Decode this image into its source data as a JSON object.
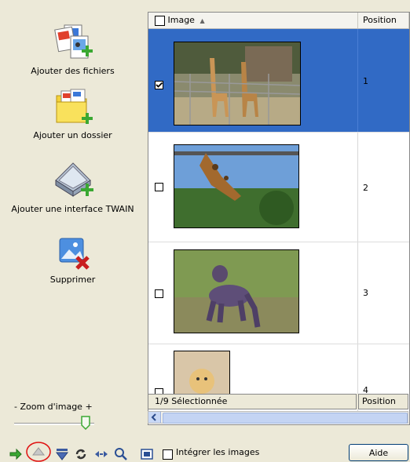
{
  "left_panel": {
    "actions": [
      {
        "label": "Ajouter des fichiers",
        "icon": "add-files-icon"
      },
      {
        "label": "Ajouter un dossier",
        "icon": "add-folder-icon"
      },
      {
        "label": "Ajouter une interface TWAIN",
        "icon": "twain-scanner-icon"
      },
      {
        "label": "Supprimer",
        "icon": "delete-image-icon"
      }
    ],
    "zoom": {
      "label": "- Zoom d'image +",
      "value": 0.85
    }
  },
  "grid": {
    "columns": {
      "image": "Image",
      "position": "Position"
    },
    "sort_indicator": "▲",
    "rows": [
      {
        "position": "1",
        "checked": true,
        "selected": true
      },
      {
        "position": "2",
        "checked": false,
        "selected": false
      },
      {
        "position": "3",
        "checked": false,
        "selected": false
      },
      {
        "position": "4",
        "checked": false,
        "selected": false
      }
    ]
  },
  "status": {
    "selection": "1/9 Sélectionnée",
    "position": "Position"
  },
  "toolbar": {
    "icons": [
      "import-arrow-icon",
      "move-up-icon",
      "move-down-icon",
      "rotate-icon",
      "flip-icon",
      "zoom-icon",
      "preview-icon"
    ],
    "integrate_label": "Intégrer les images",
    "help_label": "Aide"
  },
  "colors": {
    "selection": "#316ac5",
    "accent_green": "#3aa832",
    "highlight_ring": "#e01010"
  }
}
